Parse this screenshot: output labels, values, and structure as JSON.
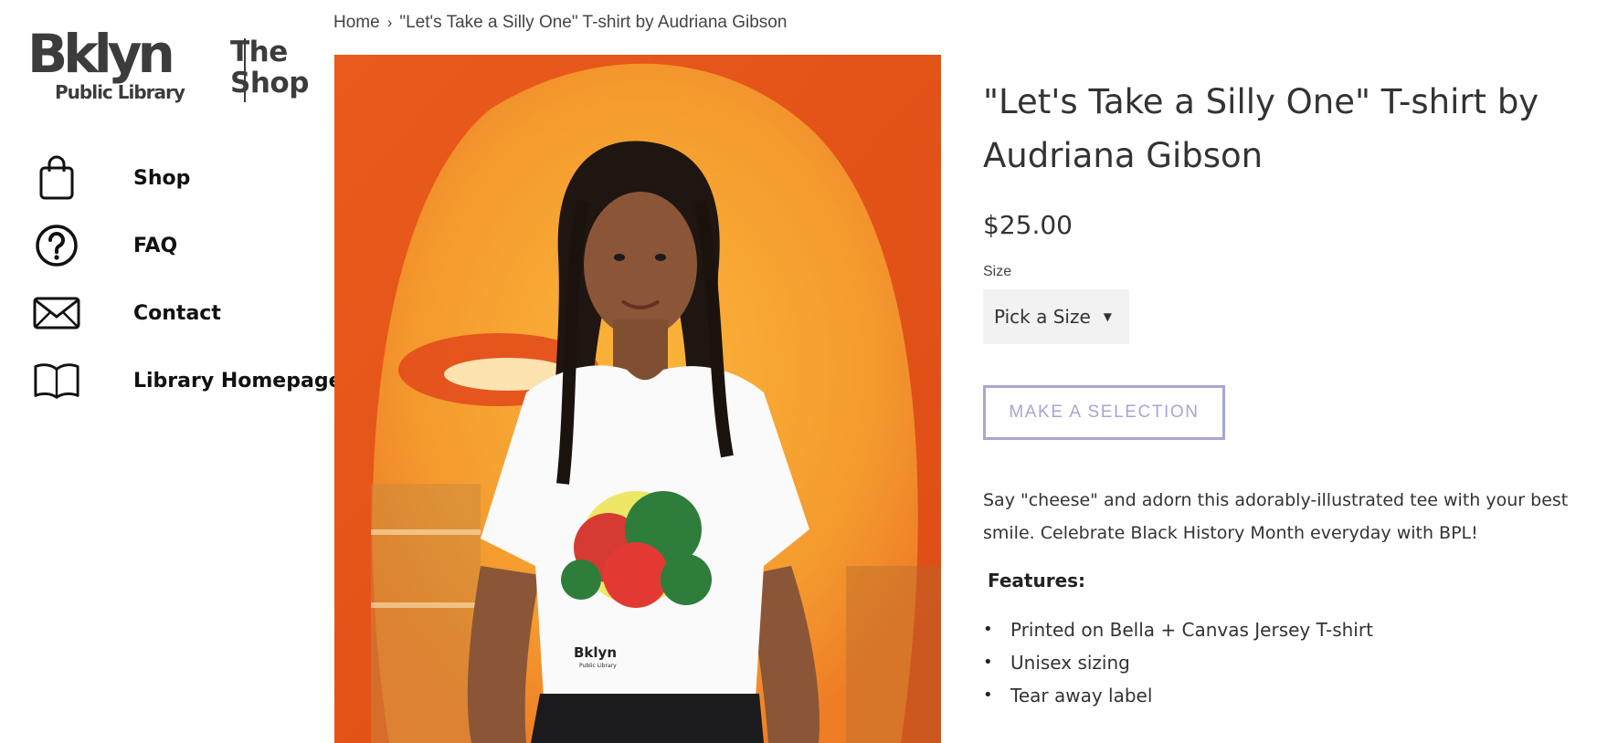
{
  "logo": {
    "bklyn": "Bklyn",
    "public_library": "Public Library",
    "the": "The",
    "shop": "Shop"
  },
  "nav": {
    "items": [
      {
        "label": "Shop",
        "icon": "shopping-bag-icon"
      },
      {
        "label": "FAQ",
        "icon": "question-circle-icon"
      },
      {
        "label": "Contact",
        "icon": "envelope-icon"
      },
      {
        "label": "Library Homepage",
        "icon": "open-book-icon"
      }
    ]
  },
  "breadcrumb": {
    "home": "Home",
    "separator": "›",
    "current": "\"Let's Take a Silly One\" T-shirt by Audriana Gibson"
  },
  "product": {
    "title": "\"Let's Take a Silly One\" T-shirt by Audriana Gibson",
    "price": "$25.00",
    "size_label": "Size",
    "size_selected": "Pick a Size",
    "button_label": "MAKE A SELECTION",
    "description": "Say \"cheese\" and adorn this adorably-illustrated tee with your best smile. Celebrate Black History Month everyday with BPL!",
    "features_heading": "Features:",
    "features": [
      "Printed on Bella + Canvas Jersey T-shirt",
      "Unisex sizing",
      "Tear away label"
    ],
    "shirt_print_text": "Bklyn",
    "shirt_print_subtext": "Public Library"
  },
  "colors": {
    "accent": "#a8a6d4",
    "background_orange": "#e3531a",
    "text": "#333333"
  }
}
